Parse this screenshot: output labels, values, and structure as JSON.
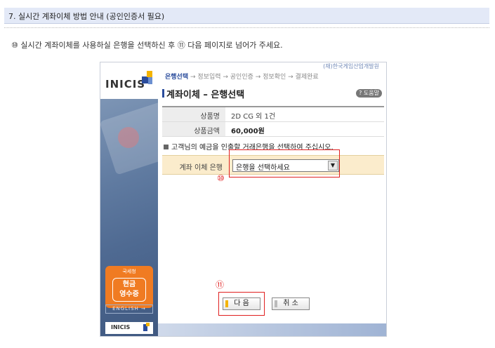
{
  "section": {
    "title": "7. 실시간 계좌이체 방법 안내 (공인인증서 필요)"
  },
  "instruction": "⑩ 실시간 계좌이체를 사용하실 은행을 선택하신 후 ⑪ 다음 페이지로 넘어가 주세요.",
  "screenshot": {
    "logo": "INICIS",
    "company": "(재)한국게임산업개발원",
    "steps": {
      "active": "은행선택",
      "rest": " → 정보입력 → 공인인증 → 정보확인 → 결제완료"
    },
    "page_title": "계좌이체 – 은행선택",
    "help_label": "? 도움말",
    "product": {
      "name_label": "상품명",
      "name_value": "2D CG 외 1건",
      "amount_label": "상품금액",
      "amount_value": "60,000원"
    },
    "notice": "고객님의 예금을 인출할 거래은행을 선택하여 주십시오.",
    "bank": {
      "label": "계좌 이체 은행",
      "selected": "은행을 선택하세요"
    },
    "marker_10": "⑩",
    "marker_11": "⑪",
    "next_button": "다 음",
    "cancel_button": "취 소",
    "receipt": {
      "top": "국세청",
      "line1": "현금",
      "line2": "영수증"
    },
    "english_button": "ENGLISH →",
    "mini_logo": "INICIS"
  },
  "colors": {
    "accent": "#2a4c9c",
    "highlight": "#e02020",
    "receipt_orange": "#f07b22",
    "header_bg": "#e3e9f7"
  }
}
